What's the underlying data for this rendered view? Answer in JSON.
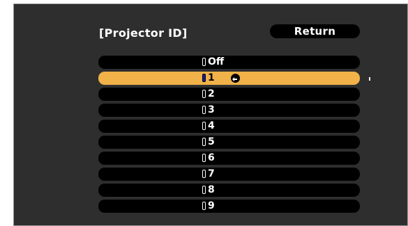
{
  "menu": {
    "title": "[Projector ID]",
    "return_label": "Return",
    "selected_index": 1,
    "options": [
      "Off",
      "1",
      "2",
      "3",
      "4",
      "5",
      "6",
      "7",
      "8",
      "9"
    ]
  },
  "colors": {
    "background": "#2e2e2e",
    "item": "#000000",
    "selected": "#f1b24a",
    "text": "#ffffff"
  },
  "icons": {
    "cursor": "cursor-icon",
    "enter": "enter-icon"
  }
}
